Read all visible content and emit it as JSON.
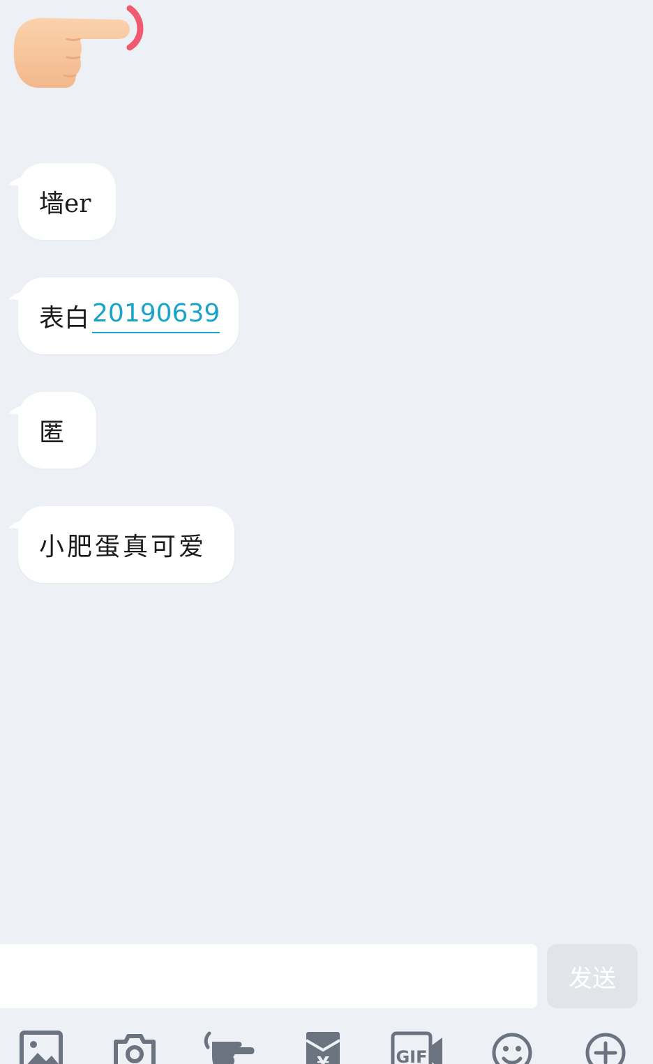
{
  "messages": [
    {
      "text": "墙er"
    },
    {
      "text": "表白",
      "link": "20190639"
    },
    {
      "text": "匿"
    },
    {
      "text": "小肥蛋真可爱"
    }
  ],
  "input": {
    "value": "",
    "placeholder": ""
  },
  "send_button": {
    "label": "发送"
  },
  "toolbar": {
    "items": [
      "image-icon",
      "camera-icon",
      "poke-hand-icon",
      "red-packet-icon",
      "gif-icon",
      "emoji-icon",
      "plus-icon"
    ]
  },
  "colors": {
    "background": "#edf1f6",
    "bubble": "#ffffff",
    "link": "#1aa3c9",
    "icon": "#6b7280",
    "send_disabled": "#e1e5ea"
  }
}
